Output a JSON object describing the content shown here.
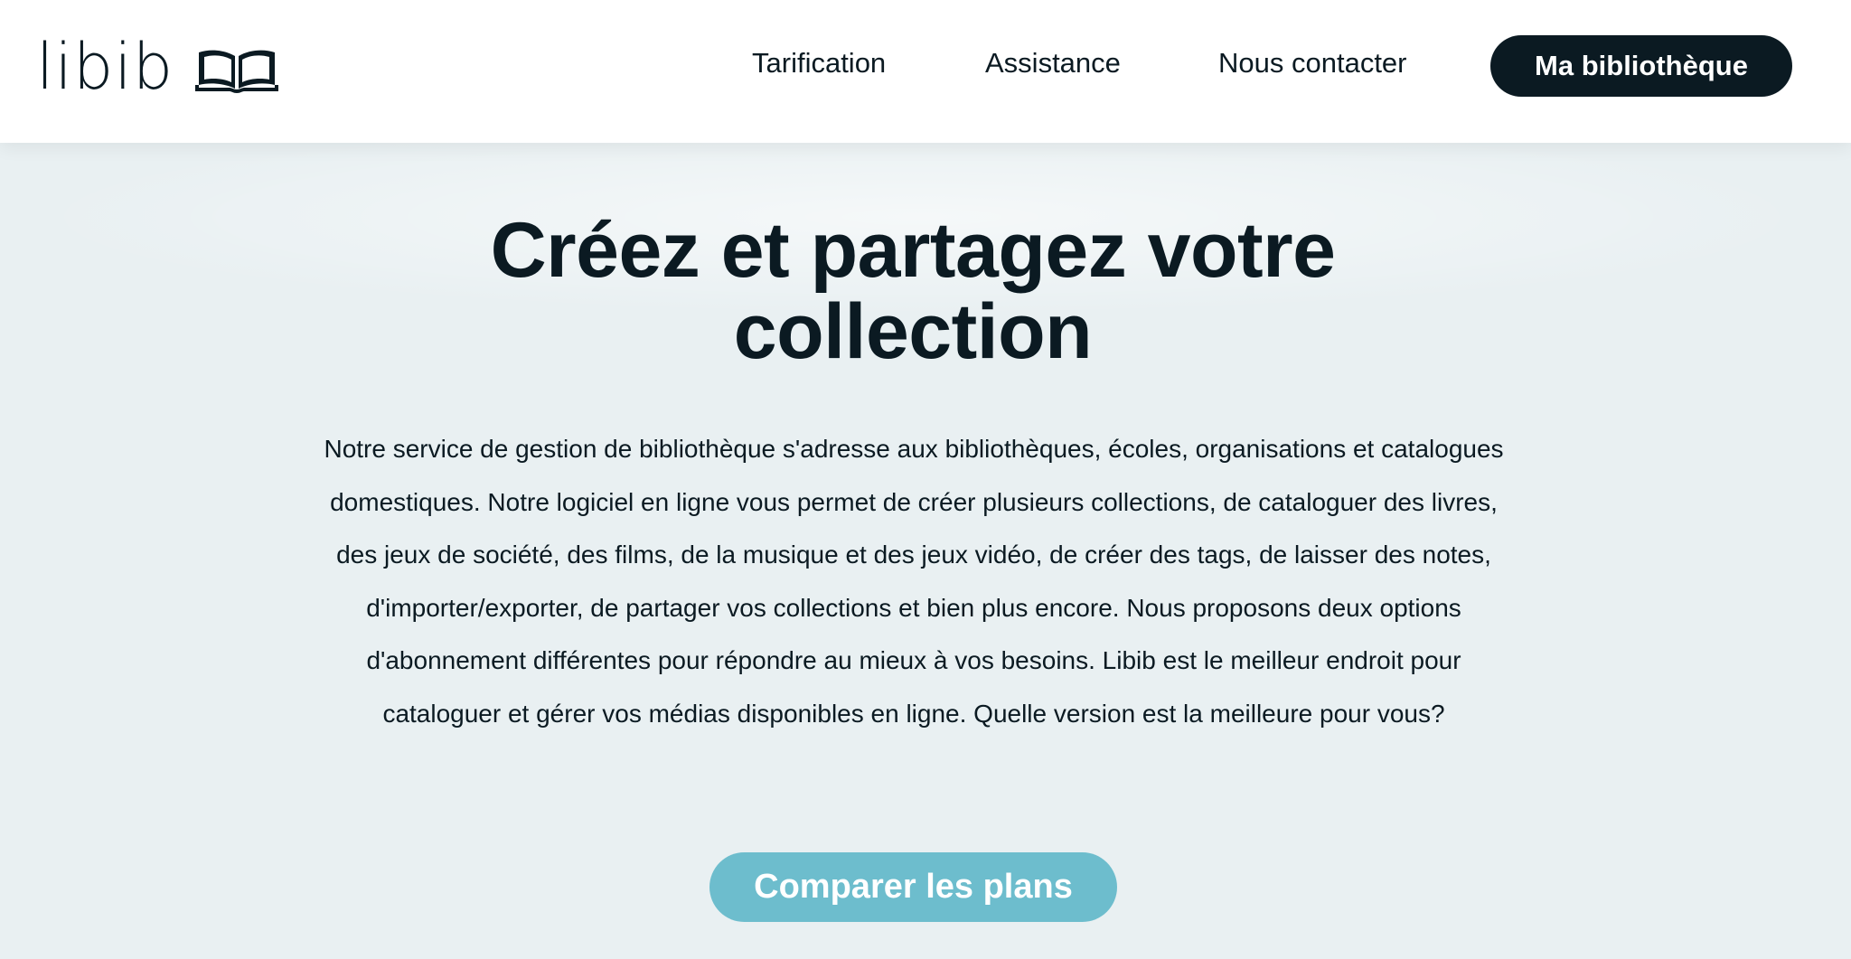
{
  "header": {
    "logo_text": "libib",
    "logo_icon": "open-book-icon",
    "nav": {
      "pricing": "Tarification",
      "support": "Assistance",
      "contact": "Nous contacter"
    },
    "my_library_button": "Ma bibliothèque"
  },
  "hero": {
    "title": "Créez et partagez votre collection",
    "description": "Notre service de gestion de bibliothèque s'adresse aux bibliothèques, écoles, organisations et catalogues domestiques. Notre logiciel en ligne vous permet de créer plusieurs collections, de cataloguer des livres, des jeux de société, des films, de la musique et des jeux vidéo, de créer des tags, de laisser des notes, d'importer/exporter, de partager vos collections et bien plus encore. Nous proposons deux options d'abonnement différentes pour répondre au mieux à vos besoins. Libib est le meilleur endroit pour cataloguer et gérer vos médias disponibles en ligne. Quelle version est la meilleure pour vous?",
    "cta_button": "Comparer les plans"
  },
  "colors": {
    "dark": "#0b1a22",
    "background": "#e9f0f2",
    "accent": "#6dbdcd",
    "header_bg": "#ffffff"
  }
}
